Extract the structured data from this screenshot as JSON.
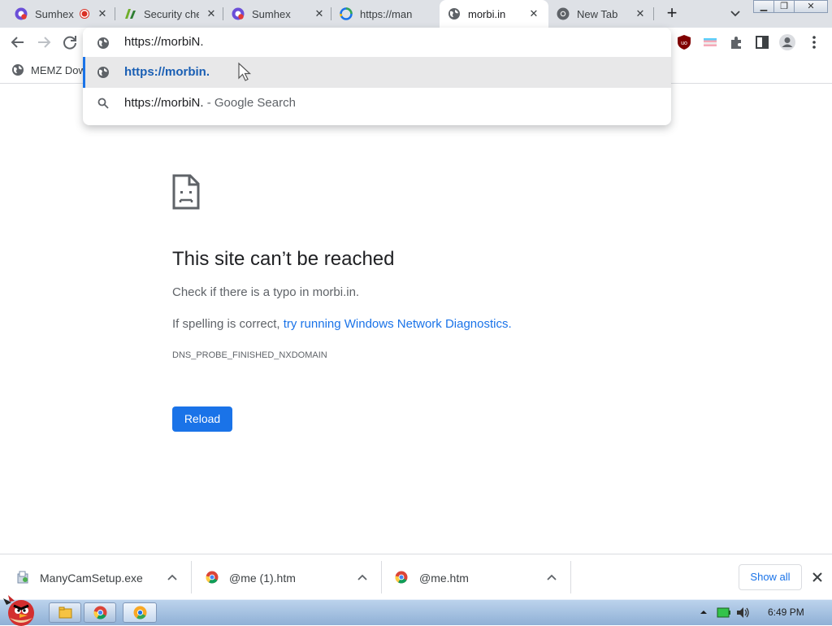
{
  "tabs": [
    {
      "title": "Sumhex",
      "icon": "sumhex-icon",
      "recording": true
    },
    {
      "title": "Security che",
      "icon": "security-check-icon"
    },
    {
      "title": "Sumhex",
      "icon": "sumhex-icon"
    },
    {
      "title": "https://man",
      "icon": "loading-spinner-icon"
    },
    {
      "title": "morbi.in",
      "icon": "globe-icon",
      "active": true
    },
    {
      "title": "New Tab",
      "icon": "chrome-icon"
    }
  ],
  "toolbar": {
    "address_value": "https://morbiN."
  },
  "bookmarks": [
    {
      "label": "MEMZ Dow",
      "icon": "globe-icon"
    }
  ],
  "omnibox": {
    "suggestions": [
      {
        "text": "https://morbin.",
        "suffix": "",
        "icon": "globe-icon",
        "selected": true
      },
      {
        "text": "https://morbiN.",
        "suffix": " - Google Search",
        "icon": "search-icon"
      }
    ]
  },
  "error": {
    "title": "This site can’t be reached",
    "typo_line": "Check if there is a typo in morbi.in.",
    "spelling_prefix": "If spelling is correct, ",
    "diagnostics_link": "try running Windows Network Diagnostics",
    "spelling_suffix": ".",
    "code": "DNS_PROBE_FINISHED_NXDOMAIN",
    "reload_label": "Reload"
  },
  "downloads": [
    {
      "name": "ManyCamSetup.exe",
      "icon": "installer-icon"
    },
    {
      "name": "@me (1).htm",
      "icon": "chrome-icon"
    },
    {
      "name": "@me.htm",
      "icon": "chrome-icon"
    }
  ],
  "shelf": {
    "show_all_label": "Show all"
  },
  "taskbar": {
    "time": "6:49 PM"
  },
  "colors": {
    "accent": "#1a73e8",
    "tabstrip": "#dee1e6",
    "taskbar": "#a8c4e4"
  }
}
